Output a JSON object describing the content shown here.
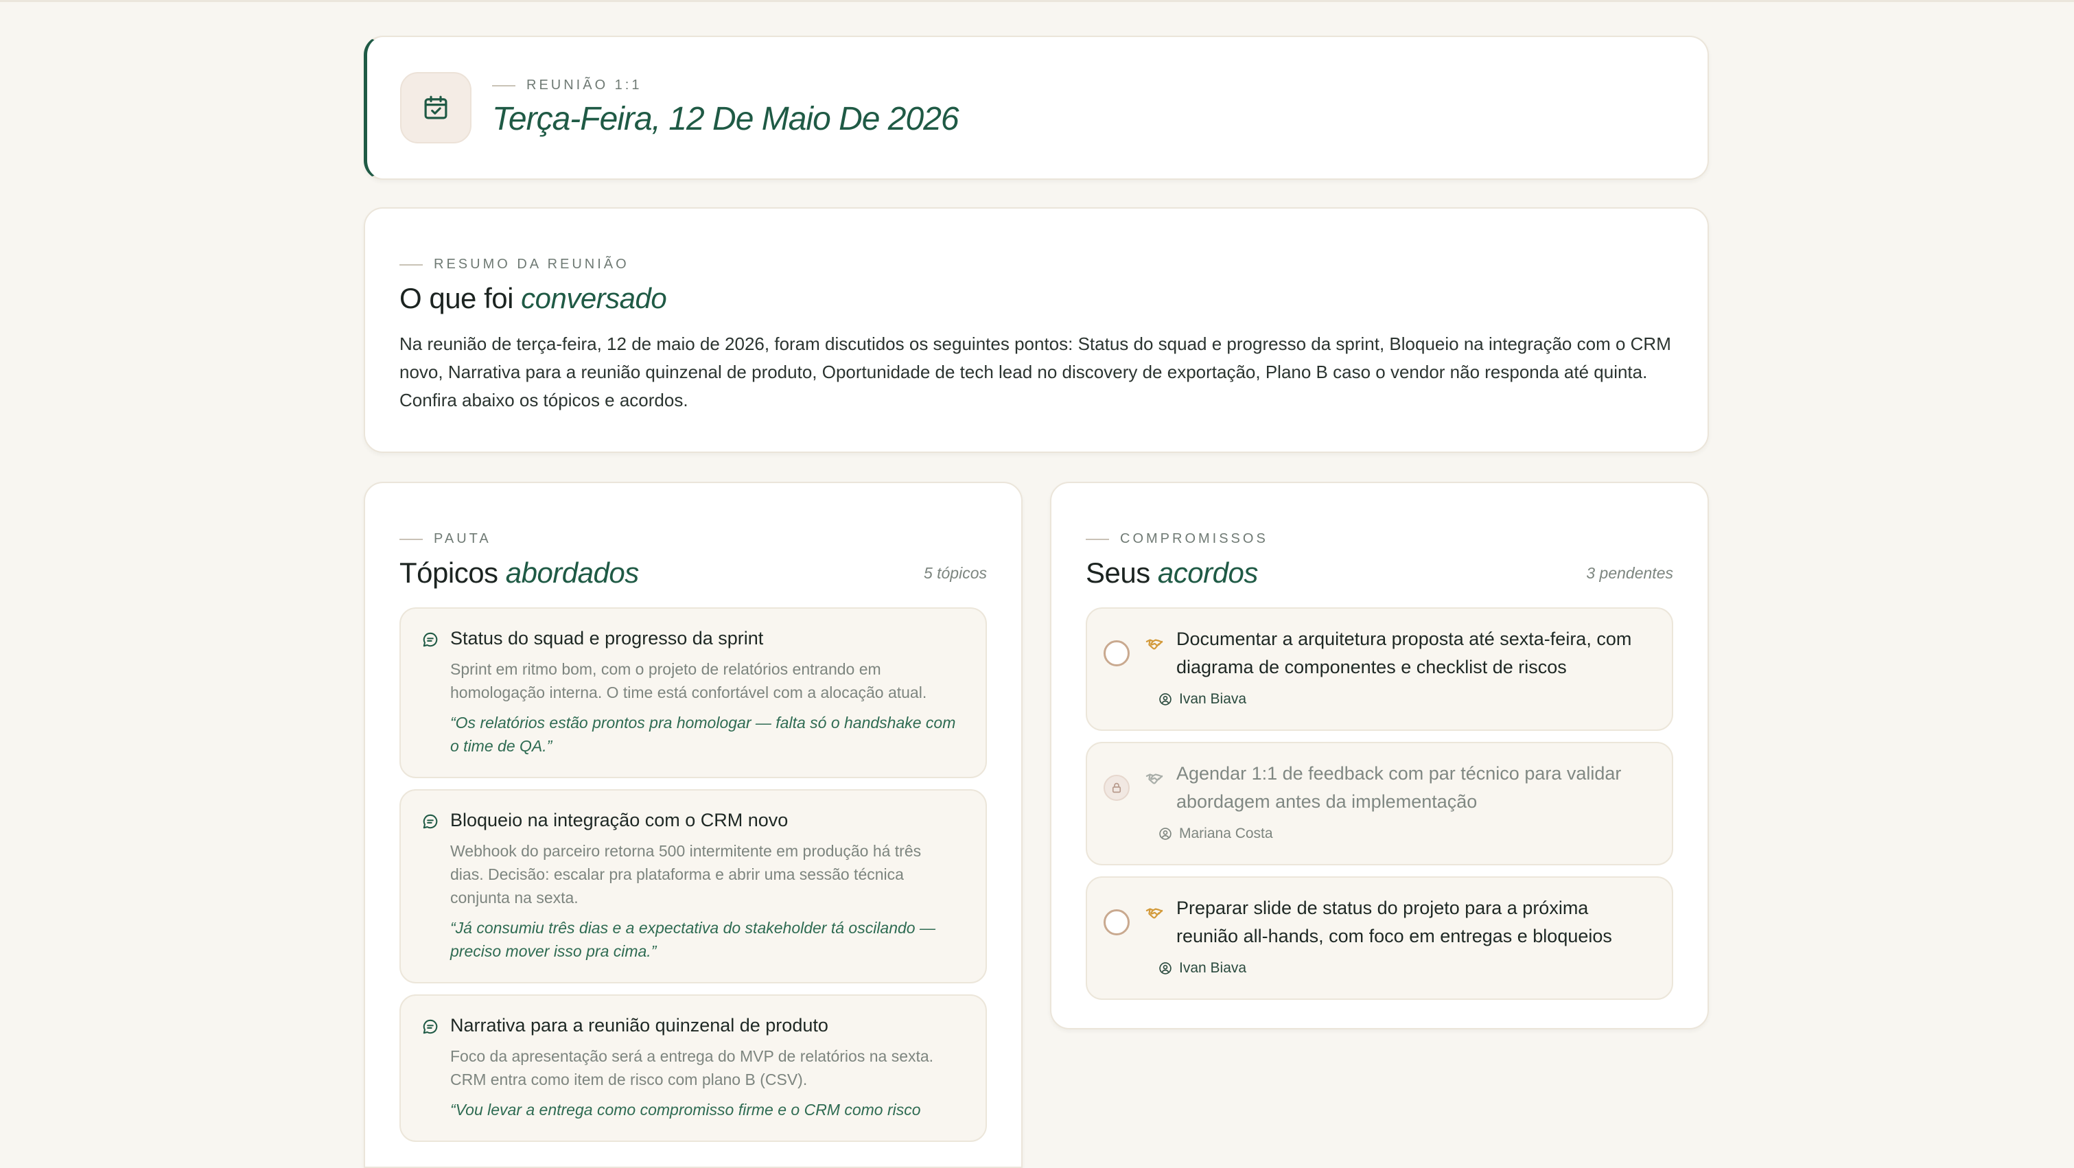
{
  "header": {
    "eyebrow": "REUNIÃO 1:1",
    "title": "Terça-Feira, 12 De Maio De 2026",
    "icon": "calendar-check-icon"
  },
  "summary": {
    "eyebrow": "RESUMO DA REUNIÃO",
    "title_plain": "O que foi ",
    "title_em": "conversado",
    "text": "Na reunião de terça-feira, 12 de maio de 2026, foram discutidos os seguintes pontos: Status do squad e progresso da sprint, Bloqueio na integração com o CRM novo, Narrativa para a reunião quinzenal de produto, Oportunidade de tech lead no discovery de exportação, Plano B caso o vendor não responda até quinta. Confira abaixo os tópicos e acordos."
  },
  "agenda": {
    "eyebrow": "PAUTA",
    "title_plain": "Tópicos ",
    "title_em": "abordados",
    "count": "5 tópicos",
    "topics": [
      {
        "title": "Status do squad e progresso da sprint",
        "desc": "Sprint em ritmo bom, com o projeto de relatórios entrando em homologação interna. O time está confortável com a alocação atual.",
        "quote": "“Os relatórios estão prontos pra homologar — falta só o handshake com o time de QA.”"
      },
      {
        "title": "Bloqueio na integração com o CRM novo",
        "desc": "Webhook do parceiro retorna 500 intermitente em produção há três dias. Decisão: escalar pra plataforma e abrir uma sessão técnica conjunta na sexta.",
        "quote": "“Já consumiu três dias e a expectativa do stakeholder tá oscilando — preciso mover isso pra cima.”"
      },
      {
        "title": "Narrativa para a reunião quinzenal de produto",
        "desc": "Foco da apresentação será a entrega do MVP de relatórios na sexta. CRM entra como item de risco com plano B (CSV).",
        "quote": "“Vou levar a entrega como compromisso firme e o CRM como risco"
      }
    ]
  },
  "commitments": {
    "eyebrow": "COMPROMISSOS",
    "title_plain": "Seus ",
    "title_em": "acordos",
    "count": "3 pendentes",
    "items": [
      {
        "title": "Documentar a arquitetura proposta até sexta-feira, com diagrama de componentes e checklist de riscos",
        "owner": "Ivan Biava",
        "state": "open"
      },
      {
        "title": "Agendar 1:1 de feedback com par técnico para validar abordagem antes da implementação",
        "owner": "Mariana Costa",
        "state": "locked"
      },
      {
        "title": "Preparar slide de status do projeto para a próxima reunião all-hands, com foco em entregas e bloqueios",
        "owner": "Ivan Biava",
        "state": "open"
      }
    ]
  },
  "colors": {
    "accent": "#1f5a45",
    "background": "#f8f6f1",
    "handshake": "#d39a3a"
  }
}
